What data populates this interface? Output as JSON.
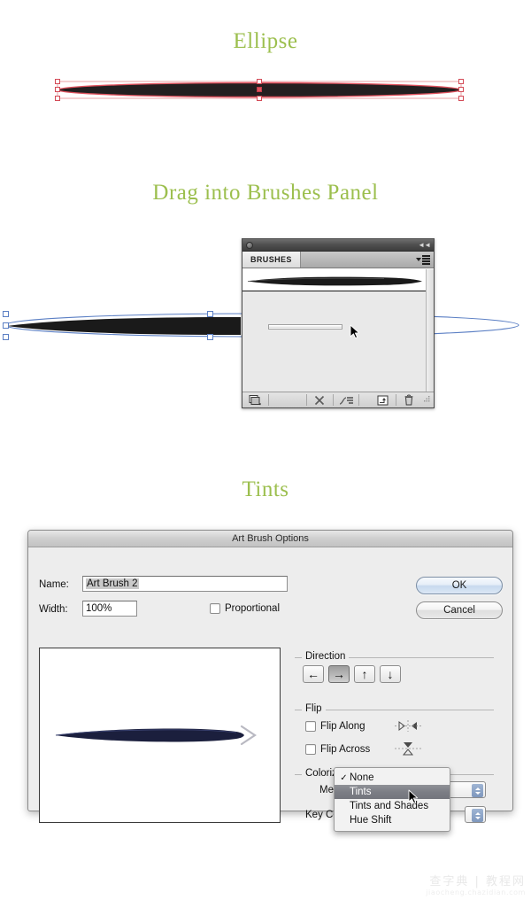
{
  "steps": {
    "ellipse_heading": "Ellipse",
    "drag_heading": "Drag into Brushes Panel",
    "tints_heading": "Tints"
  },
  "brushes_panel": {
    "tab_label": "BRUSHES",
    "menu_icon": "panel-menu-icon",
    "collapse_icon": "collapse-icon",
    "footer_buttons": [
      {
        "name": "brush-libraries-button",
        "icon": "libraries-icon"
      },
      {
        "name": "remove-brush-stroke-button",
        "icon": "x-icon"
      },
      {
        "name": "options-of-selected-object-button",
        "icon": "stroke-options-icon"
      },
      {
        "name": "new-brush-button",
        "icon": "new-brush-icon"
      },
      {
        "name": "delete-brush-button",
        "icon": "trash-icon"
      }
    ]
  },
  "dialog": {
    "title": "Art Brush Options",
    "name_label": "Name:",
    "name_value": "Art Brush 2",
    "width_label": "Width:",
    "width_value": "100%",
    "proportional_label": "Proportional",
    "proportional_checked": false,
    "ok_label": "OK",
    "cancel_label": "Cancel",
    "direction": {
      "group_label": "Direction",
      "buttons": [
        {
          "name": "direction-left-button",
          "glyph": "←",
          "selected": false
        },
        {
          "name": "direction-right-button",
          "glyph": "→",
          "selected": true
        },
        {
          "name": "direction-up-button",
          "glyph": "↑",
          "selected": false
        },
        {
          "name": "direction-down-button",
          "glyph": "↓",
          "selected": false
        }
      ]
    },
    "flip": {
      "group_label": "Flip",
      "along_label": "Flip Along",
      "along_checked": false,
      "across_label": "Flip Across",
      "across_checked": false
    },
    "colorization": {
      "group_label": "Colorization",
      "method_label": "Method",
      "method_value": "None",
      "key_color_label": "Key Color",
      "options": [
        {
          "label": "None",
          "checked": true,
          "highlighted": false
        },
        {
          "label": "Tints",
          "checked": false,
          "highlighted": true
        },
        {
          "label": "Tints and Shades",
          "checked": false,
          "highlighted": false
        },
        {
          "label": "Hue Shift",
          "checked": false,
          "highlighted": false
        }
      ]
    }
  },
  "colors": {
    "heading_green": "#9cbf4e",
    "selection_red": "#e0525e",
    "selection_blue": "#5b7fc4",
    "artwork_black": "#231f20",
    "preview_navy": "#1b1f3d",
    "dropdown_highlight": "#7c7e85"
  },
  "watermark": {
    "main": "查字典 | 教程网",
    "sub": "jiaocheng.chazidian.com"
  }
}
